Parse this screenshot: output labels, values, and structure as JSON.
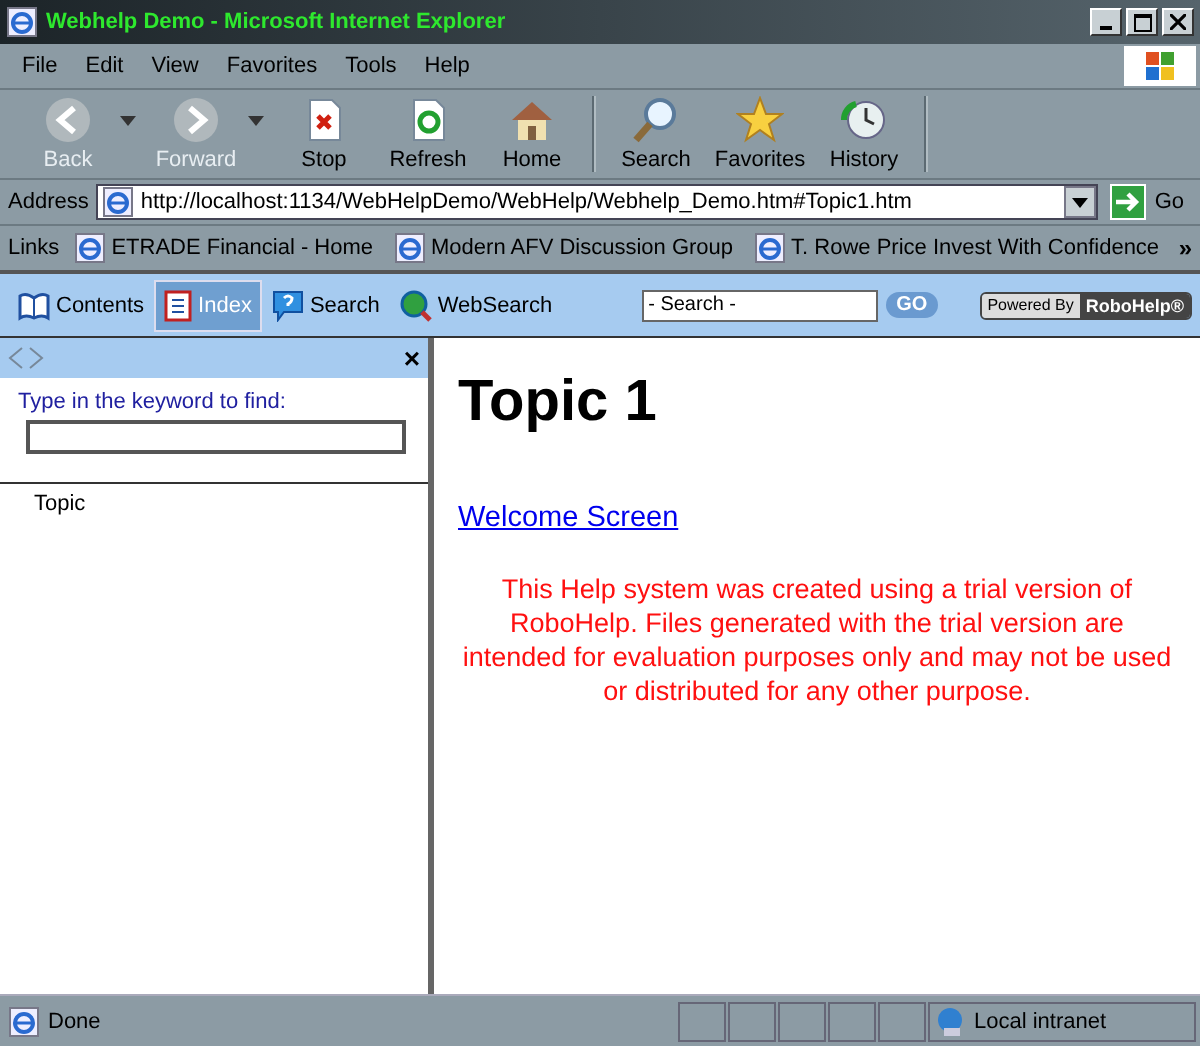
{
  "window": {
    "title": "Webhelp Demo - Microsoft Internet Explorer"
  },
  "menu": [
    "File",
    "Edit",
    "View",
    "Favorites",
    "Tools",
    "Help"
  ],
  "toolbar": [
    {
      "label": "Back",
      "kind": "back",
      "disabled": true,
      "dropdown": true
    },
    {
      "label": "Forward",
      "kind": "forward",
      "disabled": true,
      "dropdown": true
    },
    {
      "label": "Stop",
      "kind": "stop",
      "disabled": false,
      "dropdown": false
    },
    {
      "label": "Refresh",
      "kind": "refresh",
      "disabled": false,
      "dropdown": false
    },
    {
      "label": "Home",
      "kind": "home",
      "disabled": false,
      "dropdown": false
    },
    {
      "label": "Search",
      "kind": "search",
      "disabled": false,
      "dropdown": false
    },
    {
      "label": "Favorites",
      "kind": "favorites",
      "disabled": false,
      "dropdown": false
    },
    {
      "label": "History",
      "kind": "history",
      "disabled": false,
      "dropdown": false
    }
  ],
  "address": {
    "label": "Address",
    "value": "http://localhost:1134/WebHelpDemo/WebHelp/Webhelp_Demo.htm#Topic1.htm",
    "go": "Go"
  },
  "links": {
    "label": "Links",
    "items": [
      "ETRADE Financial - Home",
      "Modern AFV Discussion Group",
      "T. Rowe Price Invest With Confidence"
    ],
    "more": "»"
  },
  "help_tabs": [
    {
      "label": "Contents",
      "kind": "contents",
      "selected": false
    },
    {
      "label": "Index",
      "kind": "index",
      "selected": true
    },
    {
      "label": "Search",
      "kind": "search",
      "selected": false
    },
    {
      "label": "WebSearch",
      "kind": "websearch",
      "selected": false
    }
  ],
  "help_search": {
    "value": "- Search -",
    "button": "GO"
  },
  "powered_by": {
    "prefix": "Powered By",
    "brand": "RoboHelp®"
  },
  "index_pane": {
    "close": "×",
    "prompt": "Type in the keyword to find:",
    "keywords": [
      "Topic"
    ]
  },
  "topic": {
    "title": "Topic 1",
    "link": "Welcome Screen",
    "notice": "This Help system was created using a trial version of RoboHelp. Files generated with the trial version are intended for evaluation purposes only and may not be used or distributed for any other purpose."
  },
  "status_bar": {
    "text": "Done",
    "zone": "Local intranet"
  }
}
